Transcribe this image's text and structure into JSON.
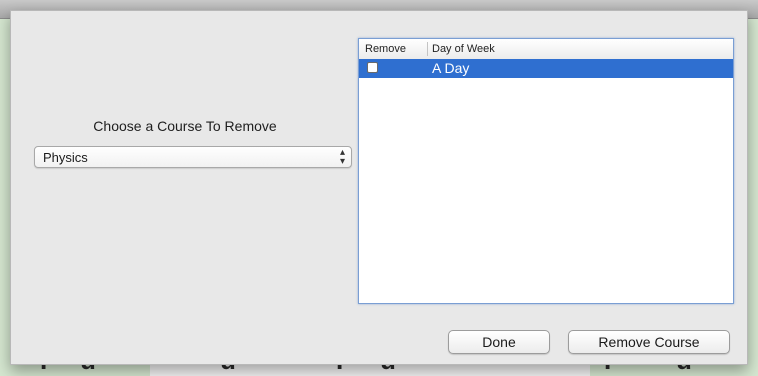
{
  "dialog": {
    "choose_label": "Choose a Course To Remove",
    "course_select": {
      "selected": "Physics"
    }
  },
  "table": {
    "columns": [
      "Remove",
      "Day of Week"
    ],
    "rows": [
      {
        "remove_checked": false,
        "day_of_week": "A Day",
        "selected": true
      }
    ]
  },
  "buttons": {
    "done": "Done",
    "remove_course": "Remove Course"
  },
  "colors": {
    "selection": "#2f6fd0",
    "focus_ring": "#7a9ed3",
    "sheet_bg": "#e8e8e8"
  }
}
